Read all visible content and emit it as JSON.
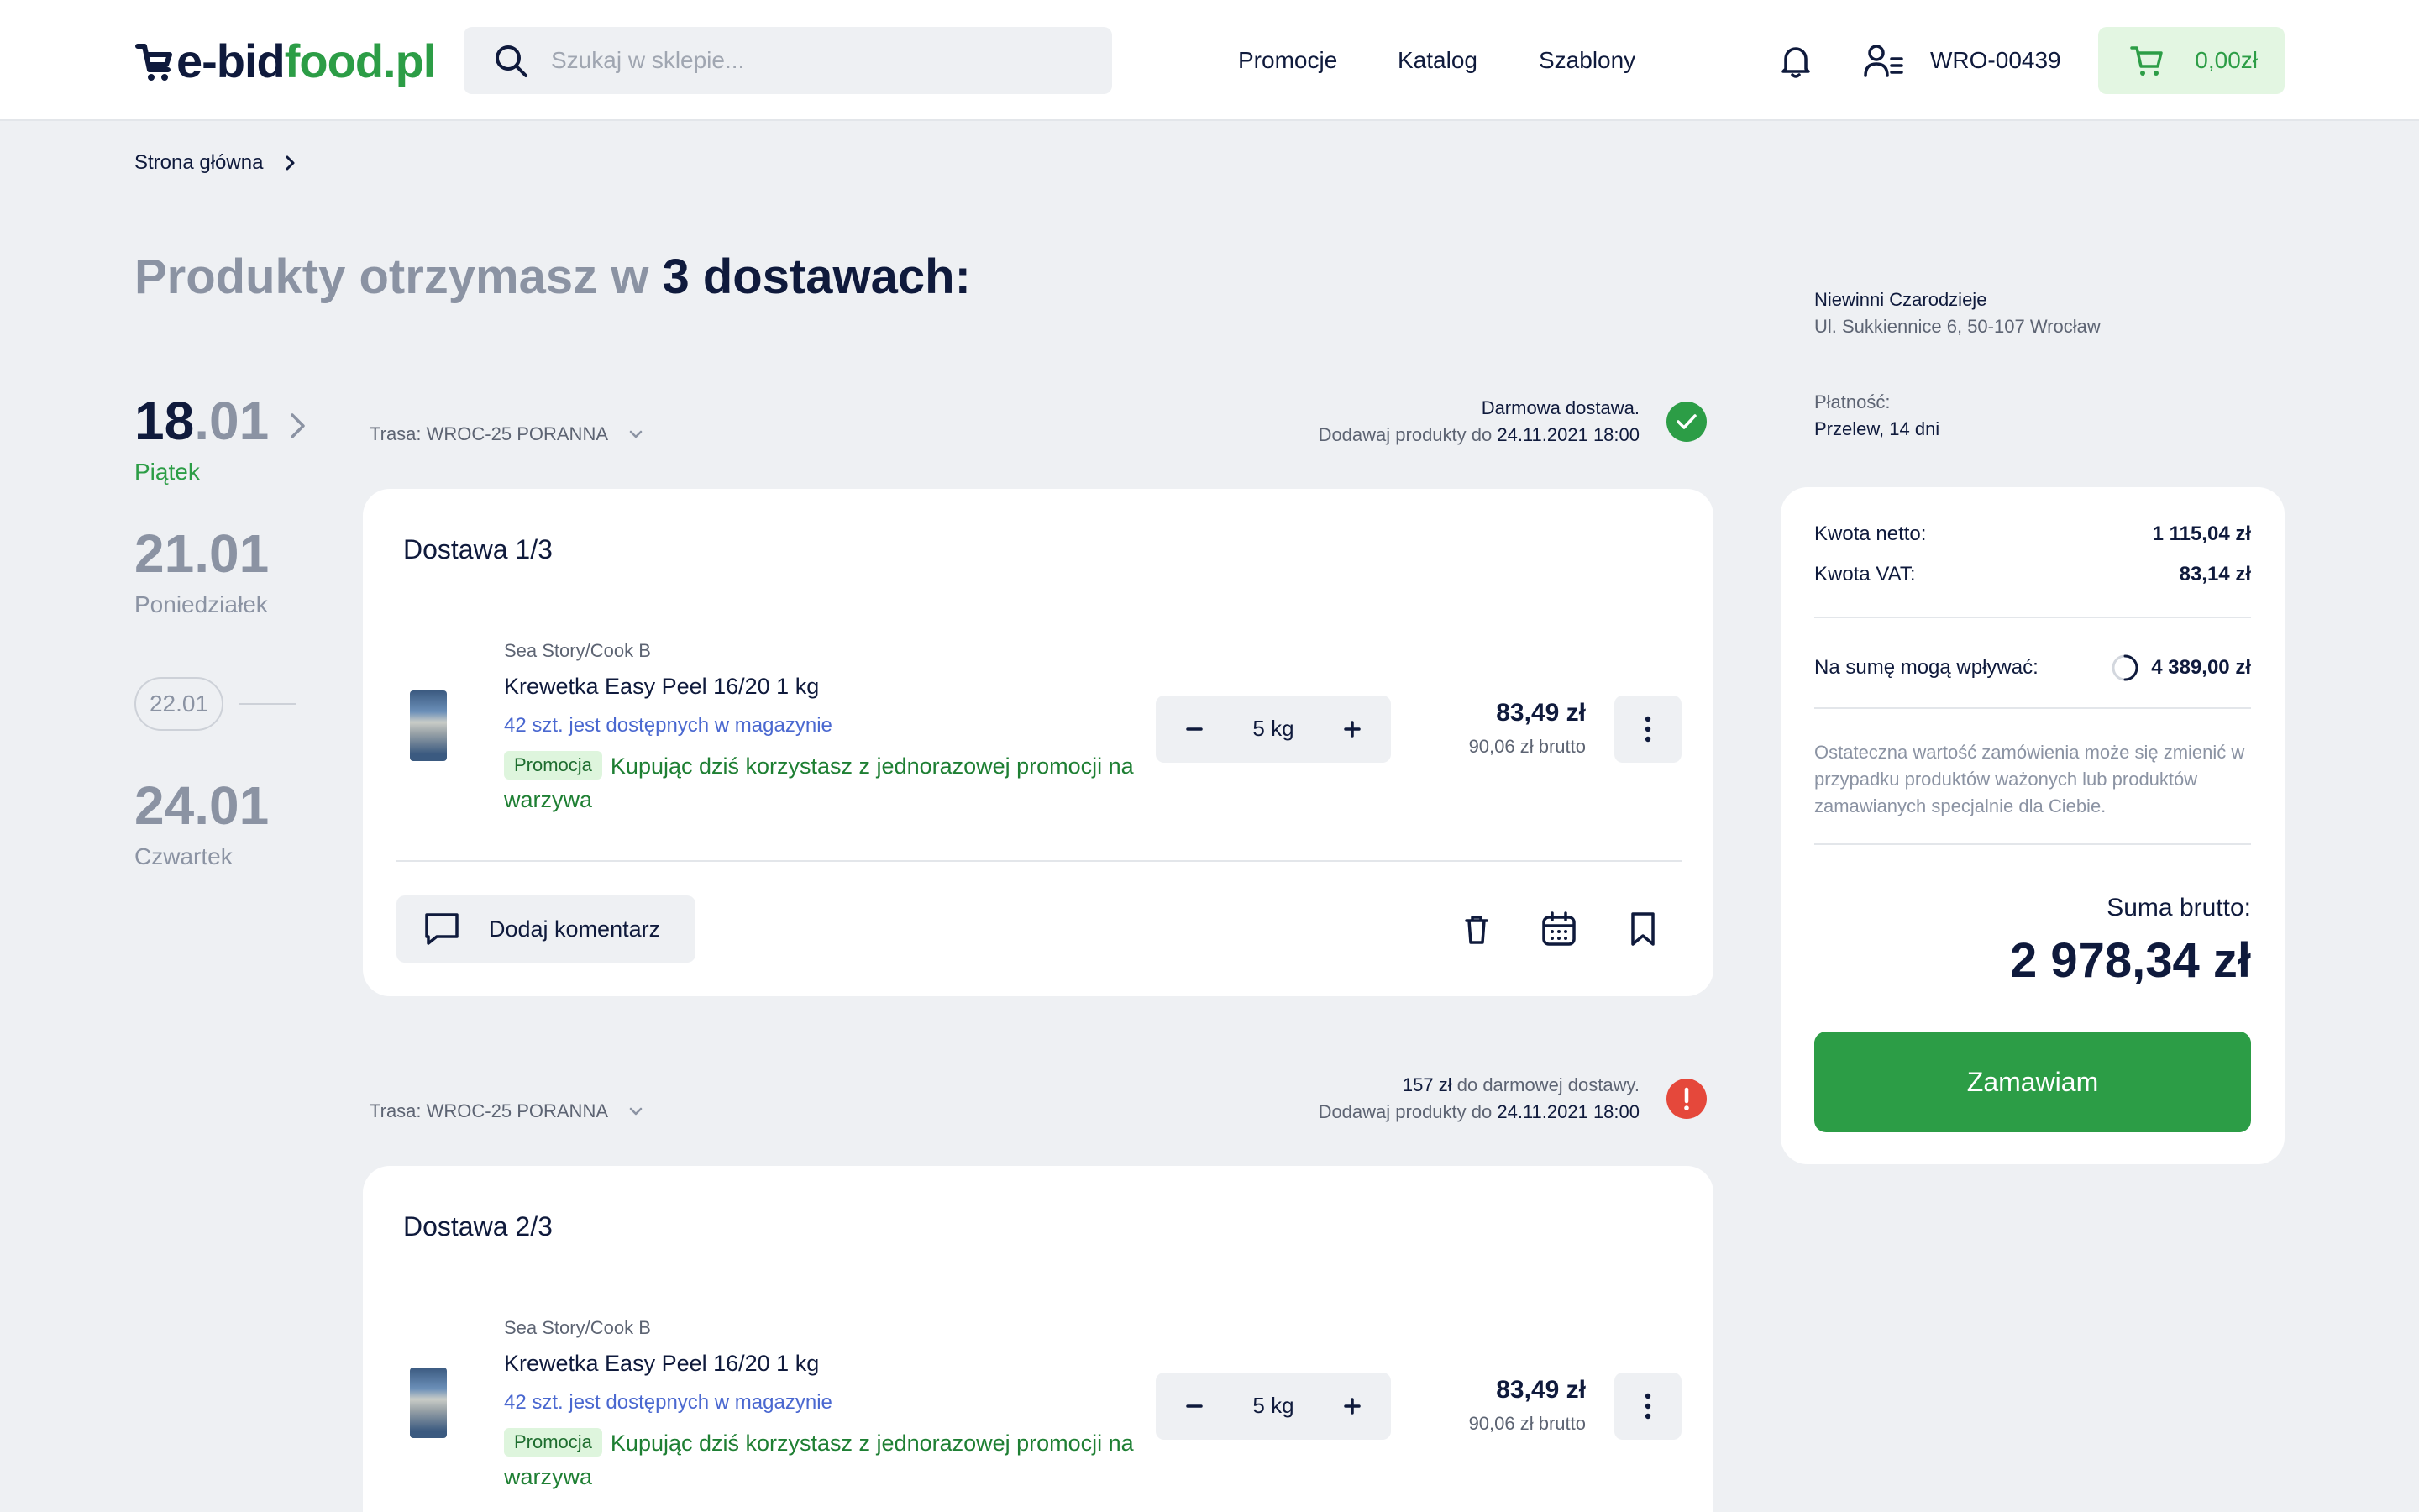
{
  "header": {
    "logo_part1": "e-bid",
    "logo_part2": "food.pl",
    "search_placeholder": "Szukaj w sklepie...",
    "nav": [
      "Promocje",
      "Katalog",
      "Szablony"
    ],
    "account_id": "WRO-00439",
    "cart_total": "0,00zł"
  },
  "breadcrumb": {
    "home": "Strona główna"
  },
  "heading": {
    "prefix": "Produkty otrzymasz w ",
    "strong": "3 dostawach:"
  },
  "dates": [
    {
      "day_num": "18",
      "month": ".01",
      "weekday": "Piątek",
      "active": true
    },
    {
      "date": "21.01",
      "weekday": "Poniedziałek"
    },
    {
      "date": "22.01"
    },
    {
      "date": "24.01",
      "weekday": "Czwartek"
    }
  ],
  "deliveries": [
    {
      "route": "Trasa: WROC-25 PORANNA",
      "meta_line1": "Darmowa dostawa.",
      "meta_line1_strong": "",
      "meta_line2_prefix": "Dodawaj produkty do ",
      "meta_line2_strong": "24.11.2021 18:00",
      "status": "ok",
      "title": "Dostawa 1/3",
      "product": {
        "brand": "Sea Story/Cook B",
        "name": "Krewetka Easy Peel 16/20 1 kg",
        "stock": "42 szt. jest dostępnych w magazynie",
        "promo_badge": "Promocja",
        "promo_text": "Kupując dziś korzystasz z jednorazowej promocji na warzywa",
        "qty": "5 kg",
        "price": "83,49 zł",
        "price_gross": "90,06 zł brutto"
      },
      "comment_label": "Dodaj komentarz"
    },
    {
      "route": "Trasa: WROC-25 PORANNA",
      "meta_line1_strong": "157 zł",
      "meta_line1": " do darmowej dostawy.",
      "meta_line2_prefix": "Dodawaj produkty do ",
      "meta_line2_strong": "24.11.2021 18:00",
      "status": "err",
      "title": "Dostawa 2/3",
      "product": {
        "brand": "Sea Story/Cook B",
        "name": "Krewetka Easy Peel 16/20 1 kg",
        "stock": "42 szt. jest dostępnych w magazynie",
        "promo_badge": "Promocja",
        "promo_text": "Kupując dziś korzystasz z jednorazowej promocji na warzywa",
        "qty": "5 kg",
        "price": "83,49 zł",
        "price_gross": "90,06 zł brutto"
      }
    }
  ],
  "sidebar": {
    "client_name": "Niewinni Czarodzieje",
    "client_address": "Ul. Sukkiennice 6, 50-107 Wrocław",
    "payment_label": "Płatność:",
    "payment_value": "Przelew, 14 dni",
    "net_label": "Kwota netto:",
    "net_value": "1 115,04 zł",
    "vat_label": "Kwota VAT:",
    "vat_value": "83,14 zł",
    "influence_label": "Na sumę mogą wpływać:",
    "influence_value": "4 389,00 zł",
    "note": "Ostateczna wartość zamówienia może się zmienić w przypadku produktów ważonych lub produktów zamawianych specjalnie dla Ciebie.",
    "total_label": "Suma brutto:",
    "total_value": "2 978,34 zł",
    "order_button": "Zamawiam"
  },
  "colors": {
    "brand_green": "#2c9d46",
    "navy": "#0f1a3c",
    "error": "#e5483b",
    "link": "#4a68d0"
  }
}
